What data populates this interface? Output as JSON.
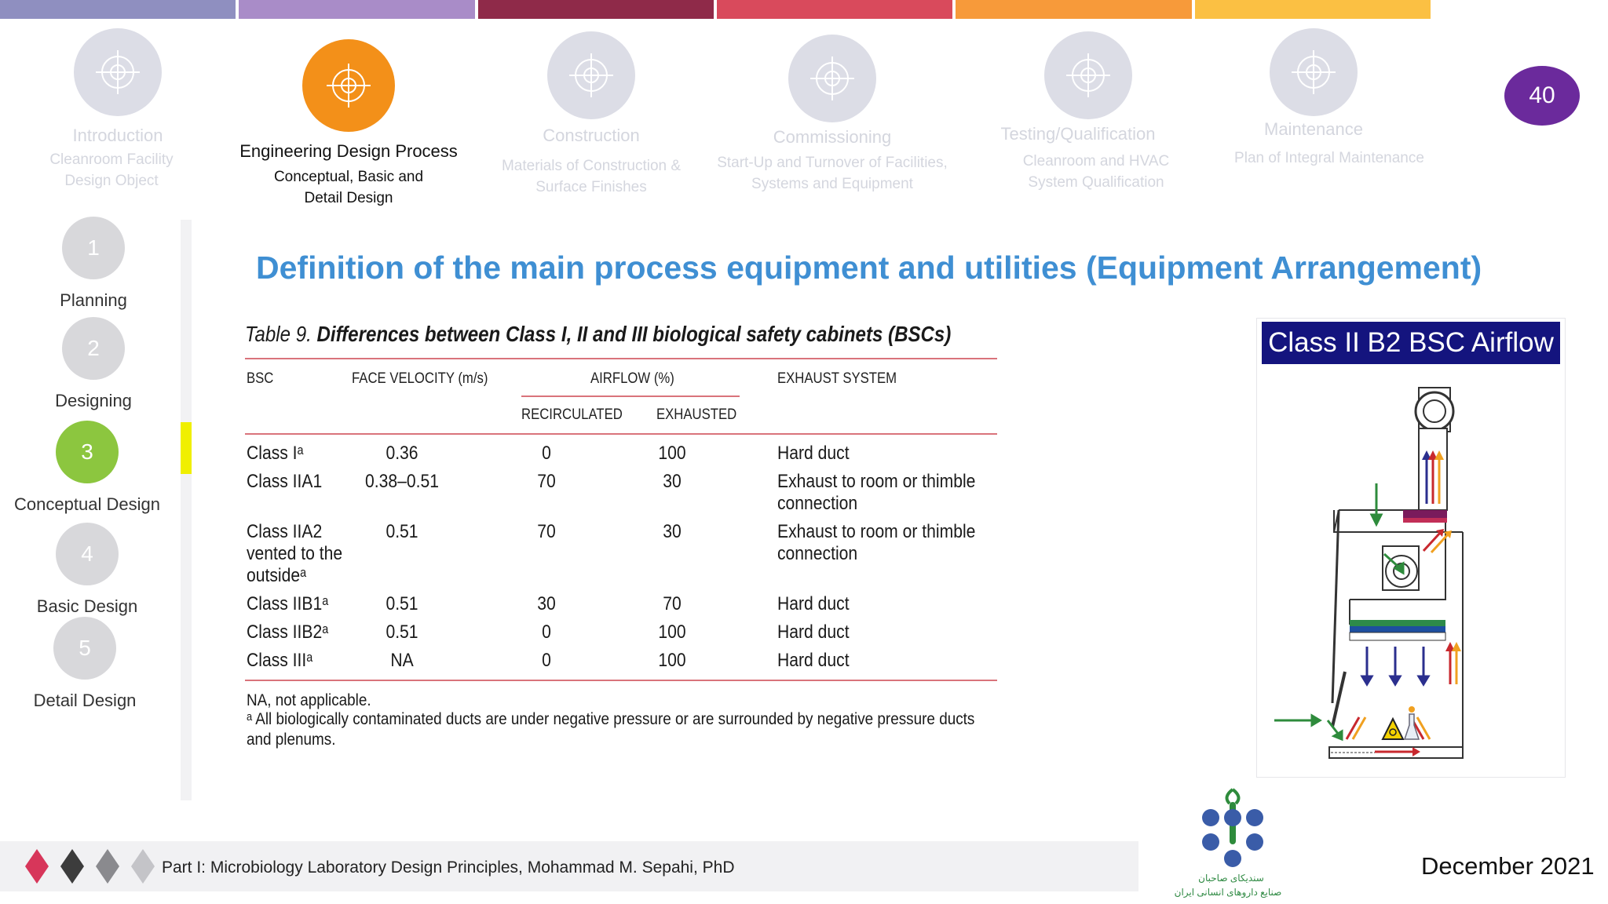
{
  "top_bar": {
    "colors": [
      "#8f8fc0",
      "#a98cc8",
      "#8f2a49",
      "#d94a5c",
      "#f79a3a",
      "#fbc043"
    ]
  },
  "stages": [
    {
      "title": "Introduction",
      "subtitle": "Cleanroom Facility Design Object",
      "active": false,
      "icon": "crosshair-icon"
    },
    {
      "title": "Engineering Design Process",
      "subtitle": "Conceptual, Basic and Detail Design",
      "active": true,
      "icon": "crosshair-icon"
    },
    {
      "title": "Construction",
      "subtitle": "Materials of Construction & Surface Finishes",
      "active": false,
      "icon": "crosshair-icon"
    },
    {
      "title": "Commissioning",
      "subtitle": "Start-Up and Turnover of Facilities, Systems and Equipment",
      "active": false,
      "icon": "crosshair-icon"
    },
    {
      "title": "Testing/Qualification",
      "subtitle": "Cleanroom and HVAC System Qualification",
      "active": false,
      "icon": "crosshair-icon"
    },
    {
      "title": "Maintenance",
      "subtitle": "Plan of Integral Maintenance",
      "active": false,
      "icon": "crosshair-icon"
    }
  ],
  "page_number": "40",
  "steps": [
    {
      "number": "1",
      "label": "Planning",
      "active": false
    },
    {
      "number": "2",
      "label": "Designing",
      "active": false
    },
    {
      "number": "3",
      "label": "Conceptual Design",
      "active": true
    },
    {
      "number": "4",
      "label": "Basic Design",
      "active": false
    },
    {
      "number": "5",
      "label": "Detail Design",
      "active": false
    }
  ],
  "main_title": "Definition of the main process equipment and utilities (Equipment Arrangement)",
  "table": {
    "caption_prefix": "Table 9.",
    "caption_text": "Differences between Class I, II and III biological safety cabinets (BSCs)",
    "headers": {
      "bsc": "BSC",
      "face_velocity": "FACE VELOCITY (m/s)",
      "airflow": "AIRFLOW (%)",
      "recirculated": "RECIRCULATED",
      "exhausted": "EXHAUSTED",
      "exhaust_system": "EXHAUST SYSTEM"
    },
    "rows": [
      {
        "bsc": "Class Iᵃ",
        "velocity": "0.36",
        "recirculated": "0",
        "exhausted": "100",
        "exhaust": "Hard duct"
      },
      {
        "bsc": "Class IIA1",
        "velocity": "0.38–0.51",
        "recirculated": "70",
        "exhausted": "30",
        "exhaust": "Exhaust to room or thimble connection"
      },
      {
        "bsc": "Class IIA2 vented to the outsideᵃ",
        "velocity": "0.51",
        "recirculated": "70",
        "exhausted": "30",
        "exhaust": "Exhaust to room or thimble connection"
      },
      {
        "bsc": "Class IIB1ᵃ",
        "velocity": "0.51",
        "recirculated": "30",
        "exhausted": "70",
        "exhaust": "Hard duct"
      },
      {
        "bsc": "Class IIB2ᵃ",
        "velocity": "0.51",
        "recirculated": "0",
        "exhausted": "100",
        "exhaust": "Hard duct"
      },
      {
        "bsc": "Class IIIᵃ",
        "velocity": "NA",
        "recirculated": "0",
        "exhausted": "100",
        "exhaust": "Hard duct"
      }
    ],
    "note1": "NA, not applicable.",
    "note2": "ᵃ All biologically contaminated ducts are under negative pressure or are surrounded by negative pressure ducts and plenums."
  },
  "diagram": {
    "title": "Class II B2 BSC Airflow"
  },
  "footer": {
    "text": "Part I: Microbiology Laboratory Design Principles, Mohammad M. Sepahi, PhD",
    "date": "December 2021",
    "logo_line1": "سندیکای صاحبان",
    "logo_line2": "صنایع داروهای انسانی ایران",
    "diamond_colors": [
      "#d7365a",
      "#3c3c3c",
      "#8a8a8e",
      "#c4c4c8"
    ]
  }
}
